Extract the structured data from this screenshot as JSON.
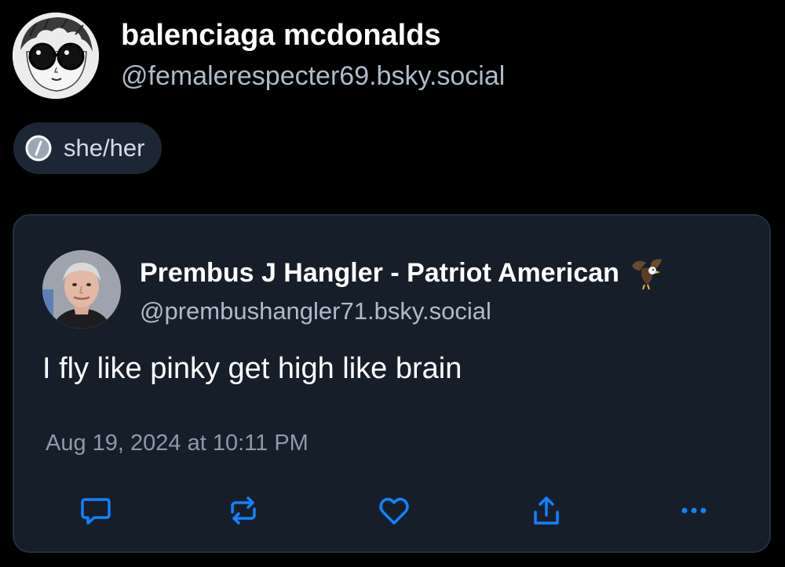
{
  "profile": {
    "display_name": "balenciaga mcdonalds",
    "handle": "@femalerespecter69.bsky.social",
    "avatar_icon": "cartoon-sunglasses-avatar",
    "pronouns": "she/her",
    "pronoun_icon": "info-icon"
  },
  "quoted_post": {
    "author_name": "Prembus J Hangler - Patriot American",
    "author_handle": "@prembushangler71.bsky.social",
    "author_badge_icon": "eagle-icon",
    "text": "I fly like pinky get high like brain",
    "timestamp": "Aug 19, 2024 at 10:11 PM",
    "actions": [
      "reply-icon",
      "repost-icon",
      "like-icon",
      "share-icon",
      "more-icon"
    ]
  },
  "colors": {
    "background": "#000000",
    "card_background": "#161e2a",
    "card_border": "#242f3e",
    "handle_text": "#aebbc9",
    "timestamp_text": "#8d9aab",
    "icon_accent": "#1083fe"
  }
}
